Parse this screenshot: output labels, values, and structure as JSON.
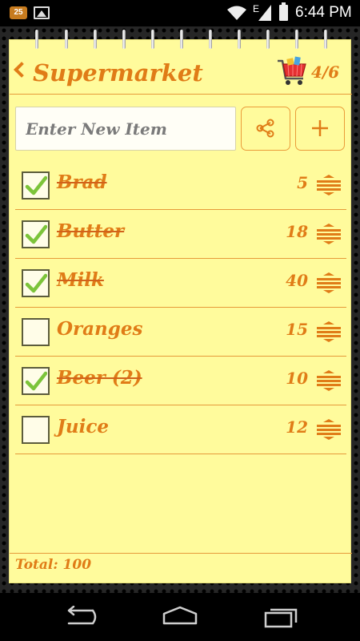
{
  "status_bar": {
    "notification_count": "25",
    "network_type": "E",
    "time": "6:44 PM",
    "icons": [
      "notification-badge-icon",
      "image-icon",
      "wifi-icon",
      "signal-icon",
      "battery-icon"
    ]
  },
  "header": {
    "title": "Supermarket",
    "count": "4/6",
    "icons": [
      "back-chevron-icon",
      "shopping-cart-icon"
    ]
  },
  "input": {
    "placeholder": "Enter New Item",
    "value": ""
  },
  "buttons": {
    "share_icon": "share-icon",
    "add_icon": "plus-icon"
  },
  "items": [
    {
      "name": "Brad",
      "qty": "5",
      "checked": true
    },
    {
      "name": "Butter",
      "qty": "18",
      "checked": true
    },
    {
      "name": "Milk",
      "qty": "40",
      "checked": true
    },
    {
      "name": "Oranges",
      "qty": "15",
      "checked": false
    },
    {
      "name": "Beer (2)",
      "qty": "10",
      "checked": true
    },
    {
      "name": "Juice",
      "qty": "12",
      "checked": false
    }
  ],
  "footer": {
    "total": "Total:  100"
  },
  "colors": {
    "paper": "#fffb9c",
    "accent": "#e07c17",
    "line": "#e69a3a",
    "check": "#7cc43a"
  }
}
